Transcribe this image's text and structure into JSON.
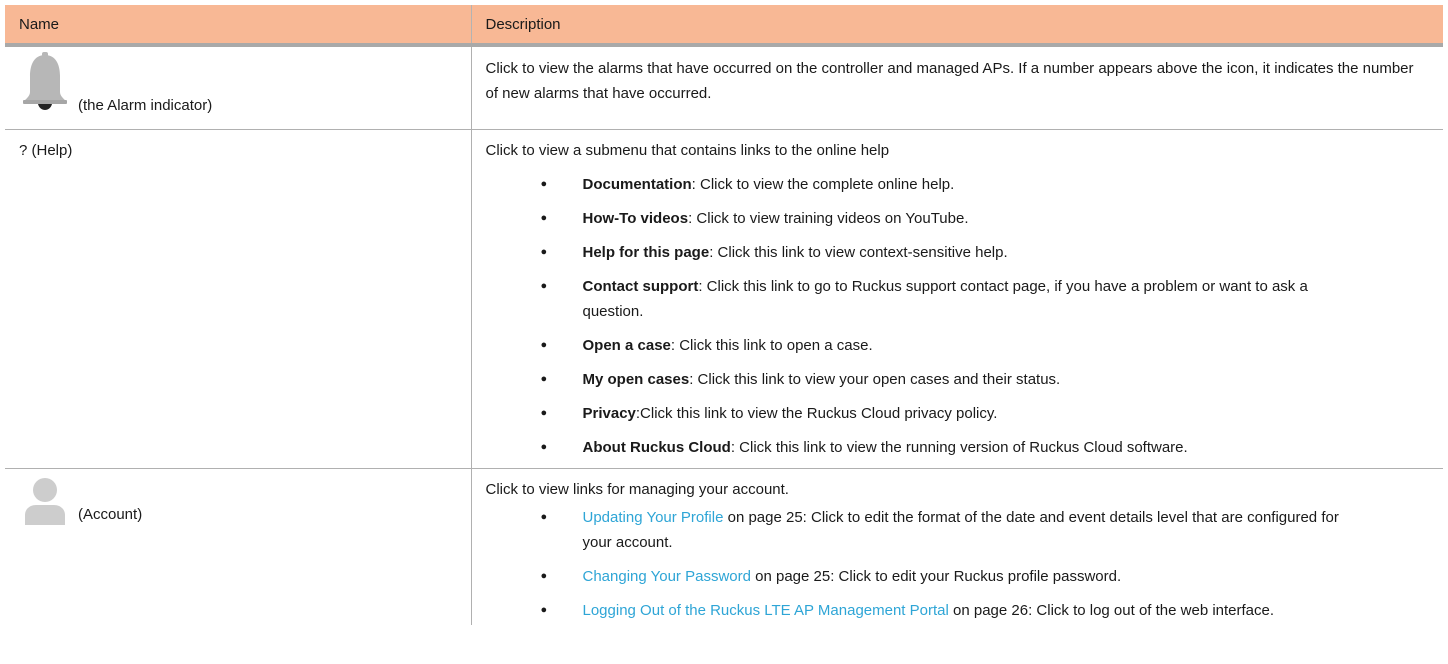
{
  "table": {
    "headers": [
      "Name",
      "Description"
    ],
    "rows": [
      {
        "name": "(the Alarm indicator)",
        "icon": "bell-icon",
        "description": "Click to view the alarms that have occurred on the controller and managed APs. If a number appears above the icon, it indicates the number of new alarms that have occurred."
      },
      {
        "name": "? (Help)",
        "intro": "Click to view a submenu that contains links to the online help",
        "items": [
          {
            "term": "Documentation",
            "text": ": Click to view the complete online help."
          },
          {
            "term": "How-To videos",
            "text": ": Click to view training videos on YouTube."
          },
          {
            "term": "Help for this page",
            "text": ": Click this link to view context-sensitive help."
          },
          {
            "term": "Contact support",
            "text": ": Click this link to go to Ruckus support contact page, if you have a problem or want to ask a question."
          },
          {
            "term": "Open a case",
            "text": ": Click this link to open a case."
          },
          {
            "term": "My open cases",
            "text": ": Click this link to view your open cases and their status."
          },
          {
            "term": "Privacy",
            "text": ":Click this link to view the Ruckus Cloud privacy policy."
          },
          {
            "term": "About Ruckus Cloud",
            "text": ": Click this link to view the running version of Ruckus Cloud software."
          }
        ]
      },
      {
        "name": "(Account)",
        "icon": "user-avatar-icon",
        "intro": "Click to view links for managing your account.",
        "links": [
          {
            "link": "Updating Your Profile",
            "text": " on page 25: Click to edit the format of the date and event details level that are configured for your account."
          },
          {
            "link": "Changing Your Password",
            "text": " on page 25: Click to edit your Ruckus profile password."
          },
          {
            "link": "Logging Out of the Ruckus LTE AP Management Portal",
            "text": " on page 26: Click to log out of the web interface."
          }
        ]
      }
    ]
  },
  "colors": {
    "header_bg": "#f8b895",
    "link": "#2ea5d6",
    "icon_gray": "#b7b7b7",
    "border": "#b0b0b0"
  }
}
